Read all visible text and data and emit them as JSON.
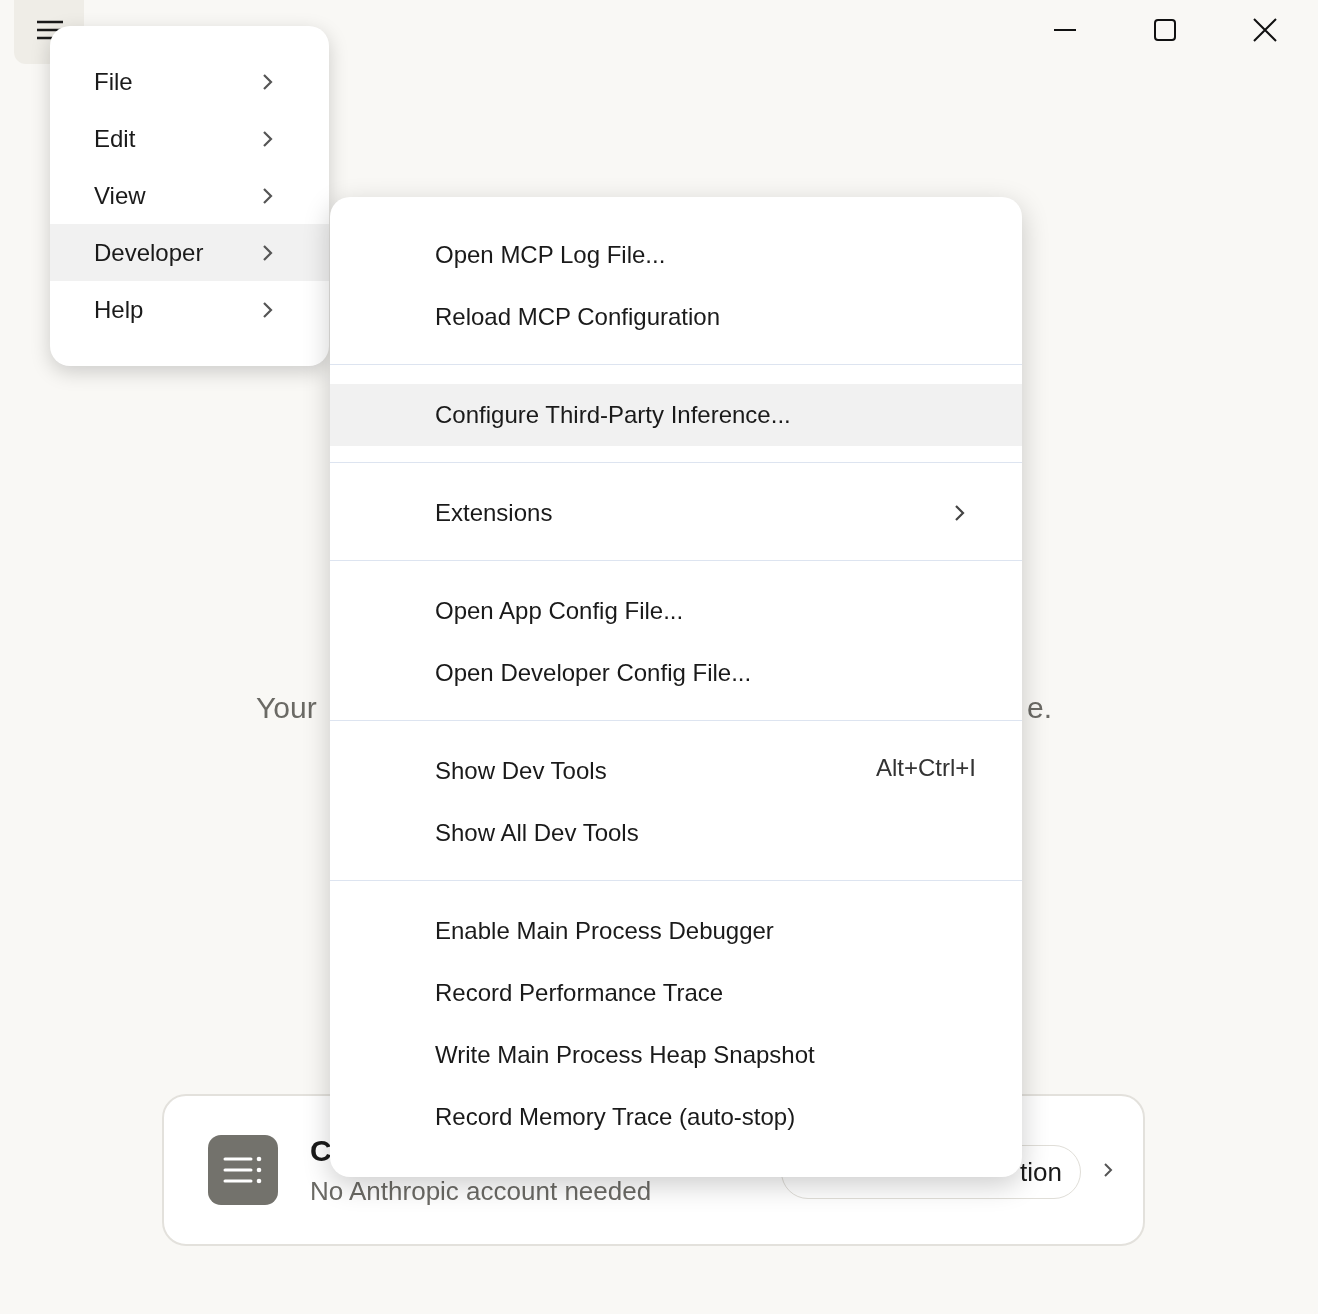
{
  "background": {
    "message_start": "Your",
    "message_end": "e.",
    "card": {
      "title": "C",
      "subtitle": "No Anthropic account needed",
      "button": "tion"
    }
  },
  "menu": {
    "items": [
      {
        "label": "File",
        "selected": false
      },
      {
        "label": "Edit",
        "selected": false
      },
      {
        "label": "View",
        "selected": false
      },
      {
        "label": "Developer",
        "selected": true
      },
      {
        "label": "Help",
        "selected": false
      }
    ]
  },
  "submenu": {
    "groups": [
      {
        "items": [
          {
            "kind": "action",
            "label": "Open MCP Log File...",
            "selected": false
          },
          {
            "kind": "action",
            "label": "Reload MCP Configuration",
            "selected": false
          }
        ]
      },
      {
        "items": [
          {
            "kind": "action",
            "label": "Configure Third-Party Inference...",
            "selected": true
          }
        ]
      },
      {
        "items": [
          {
            "kind": "submenu",
            "label": "Extensions",
            "selected": false
          }
        ]
      },
      {
        "items": [
          {
            "kind": "action",
            "label": "Open App Config File...",
            "selected": false
          },
          {
            "kind": "action",
            "label": "Open Developer Config File...",
            "selected": false
          }
        ]
      },
      {
        "items": [
          {
            "kind": "action",
            "label": "Show Dev Tools",
            "shortcut": "Alt+Ctrl+I",
            "selected": false
          },
          {
            "kind": "action",
            "label": "Show All Dev Tools",
            "selected": false
          }
        ]
      },
      {
        "items": [
          {
            "kind": "action",
            "label": "Enable Main Process Debugger",
            "selected": false
          },
          {
            "kind": "action",
            "label": "Record Performance Trace",
            "selected": false
          },
          {
            "kind": "action",
            "label": "Write Main Process Heap Snapshot",
            "selected": false
          },
          {
            "kind": "action",
            "label": "Record Memory Trace (auto-stop)",
            "selected": false
          }
        ]
      }
    ]
  }
}
